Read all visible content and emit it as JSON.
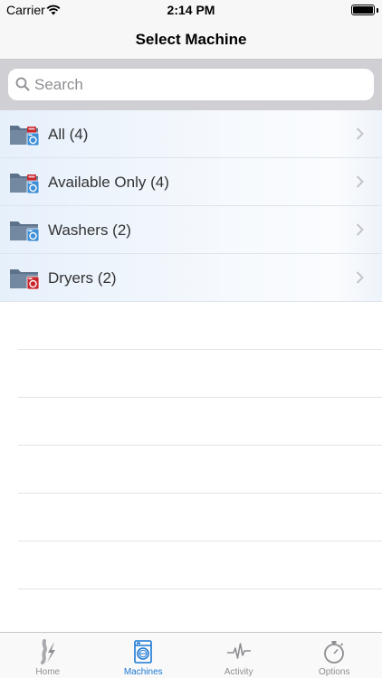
{
  "status_bar": {
    "carrier": "Carrier",
    "time": "2:14 PM",
    "battery_level": 1.0
  },
  "nav": {
    "title": "Select Machine"
  },
  "search": {
    "placeholder": "Search",
    "value": ""
  },
  "list": {
    "items": [
      {
        "label": "All (4)",
        "icon": "washer-dryer-folder-icon"
      },
      {
        "label": "Available Only (4)",
        "icon": "washer-dryer-folder-icon"
      },
      {
        "label": "Washers (2)",
        "icon": "washer-folder-icon"
      },
      {
        "label": "Dryers (2)",
        "icon": "dryer-folder-icon"
      }
    ]
  },
  "tab_bar": {
    "active": "Machines",
    "tabs": [
      {
        "label": "Home",
        "icon": "home-bolt-icon"
      },
      {
        "label": "Machines",
        "icon": "washing-machine-icon"
      },
      {
        "label": "Activity",
        "icon": "activity-pulse-icon"
      },
      {
        "label": "Options",
        "icon": "stopwatch-icon"
      }
    ]
  },
  "colors": {
    "accent": "#1a78d4",
    "washer_blue": "#3d8fd6",
    "dryer_red": "#c8262c",
    "folder": "#6a7f97",
    "inactive": "#8e8e93"
  }
}
